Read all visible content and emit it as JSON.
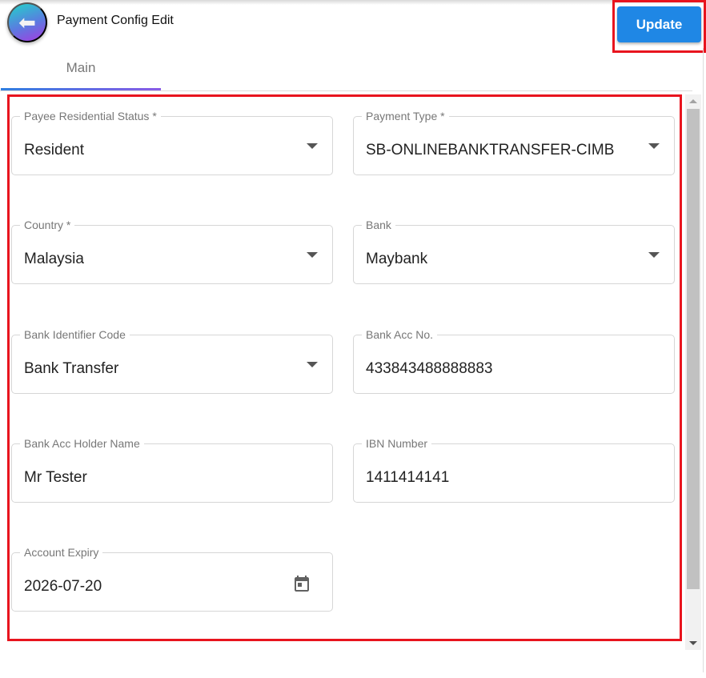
{
  "header": {
    "title": "Payment Config Edit",
    "update_label": "Update",
    "back_icon": "reply-arrow-icon"
  },
  "tabs": [
    {
      "label": "Main",
      "active": true
    }
  ],
  "fields": [
    {
      "label": "Payee Residential Status *",
      "value": "Resident",
      "type": "select"
    },
    {
      "label": "Payment Type *",
      "value": "SB-ONLINEBANKTRANSFER-CIMB",
      "type": "select"
    },
    {
      "label": "Country *",
      "value": "Malaysia",
      "type": "select"
    },
    {
      "label": "Bank",
      "value": "Maybank",
      "type": "select"
    },
    {
      "label": "Bank Identifier Code",
      "value": "Bank Transfer",
      "type": "select"
    },
    {
      "label": "Bank Acc No.",
      "value": "433843488888883",
      "type": "text"
    },
    {
      "label": "Bank Acc Holder Name",
      "value": "Mr Tester",
      "type": "text"
    },
    {
      "label": "IBN Number",
      "value": "1411414141",
      "type": "text"
    },
    {
      "label": "Account Expiry",
      "value": "2026-07-20",
      "type": "date"
    }
  ],
  "colors": {
    "accent": "#1f87e5",
    "highlight": "#e8141e"
  }
}
